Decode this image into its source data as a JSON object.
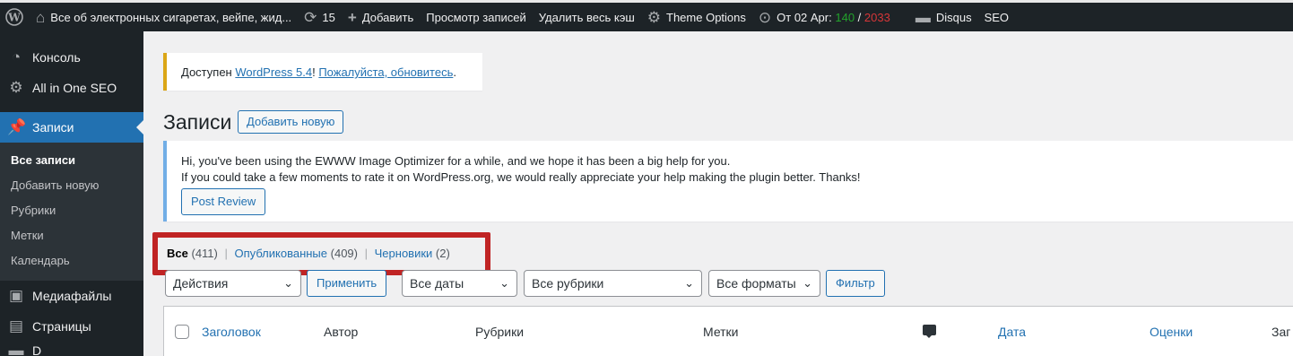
{
  "adminbar": {
    "site_title": "Все об электронных сигаретах, вейпе, жид...",
    "updates_count": "15",
    "add_new": "Добавить",
    "view_posts": "Просмотр записей",
    "clear_cache": "Удалить весь кэш",
    "theme_options": "Theme Options",
    "stats_prefix": "От 02 Apr:",
    "stats_green": "140",
    "stats_sep": " / ",
    "stats_red": "2033",
    "disqus": "Disqus",
    "seo": "SEO"
  },
  "sidebar": {
    "console": "Консоль",
    "aioseo": "All in One SEO",
    "posts": "Записи",
    "submenu": [
      "Все записи",
      "Добавить новую",
      "Рубрики",
      "Метки",
      "Календарь"
    ],
    "media": "Медиафайлы",
    "pages": "Страницы",
    "next_cut": "D"
  },
  "update_notice": {
    "prefix": "Доступен ",
    "link_version": "WordPress 5.4",
    "mid": "! ",
    "link_update": "Пожалуйста, обновитесь",
    "suffix": "."
  },
  "page": {
    "title": "Записи",
    "add_new_button": "Добавить новую"
  },
  "ewww_notice": {
    "line1": "Hi, you've been using the EWWW Image Optimizer for a while, and we hope it has been a big help for you.",
    "line2": "If you could take a few moments to rate it on WordPress.org, we would really appreciate your help making the plugin better. Thanks!",
    "button": "Post Review"
  },
  "views": {
    "all_label": "Все",
    "all_count": "(411)",
    "published_label": "Опубликованные",
    "published_count": "(409)",
    "drafts_label": "Черновики",
    "drafts_count": "(2)",
    "separator": "|"
  },
  "filters": {
    "bulk_actions": "Действия",
    "apply": "Применить",
    "dates": "Все даты",
    "categories": "Все рубрики",
    "formats": "Все форматы",
    "filter": "Фильтр"
  },
  "table": {
    "columns": [
      "Заголовок",
      "Автор",
      "Рубрики",
      "Метки",
      "Дата",
      "Оценки",
      "Заг"
    ]
  }
}
